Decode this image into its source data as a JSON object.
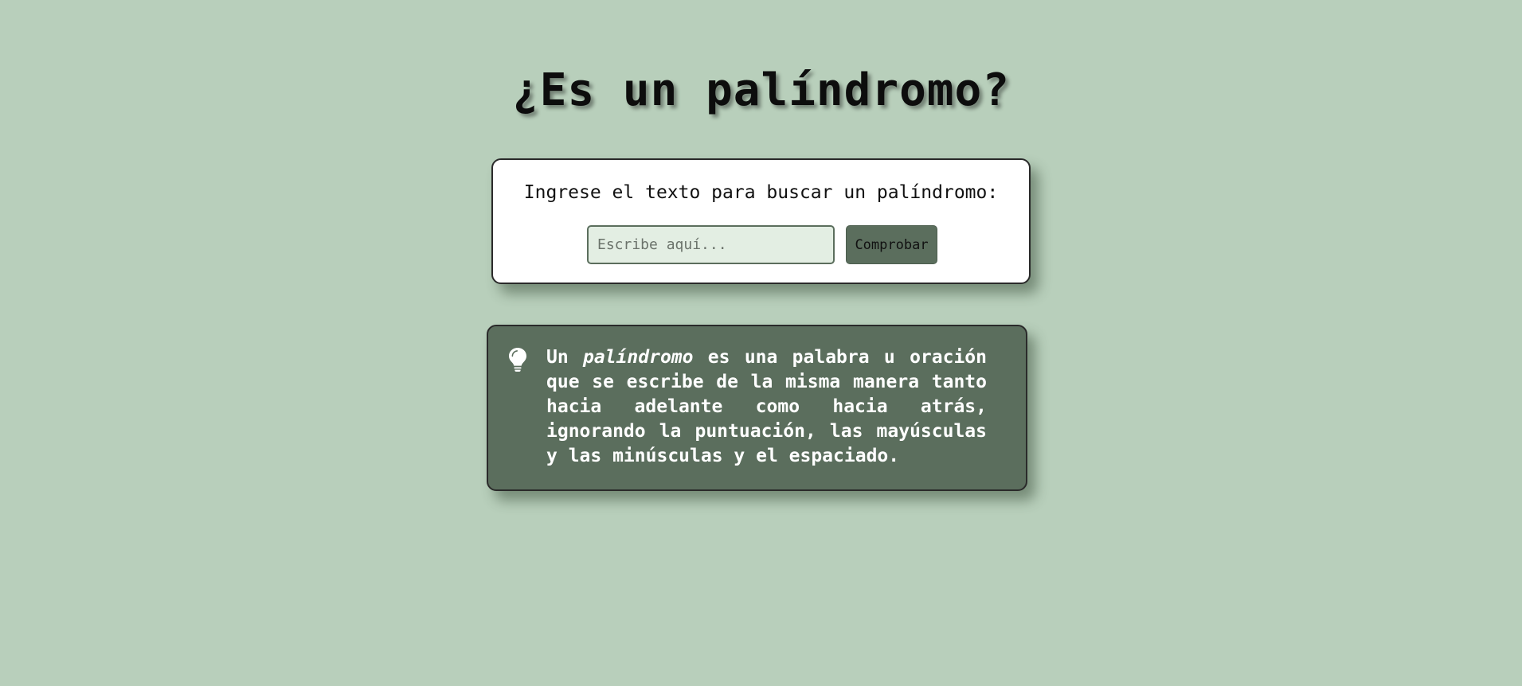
{
  "header": {
    "title": "¿Es un palíndromo?"
  },
  "checker": {
    "label": "Ingrese el texto para buscar un palíndromo:",
    "input_value": "",
    "input_placeholder": "Escribe aquí...",
    "button_label": "Comprobar"
  },
  "info": {
    "icon": "lightbulb-icon",
    "text_before": "Un ",
    "text_emphasis": "palíndromo",
    "text_after": " es una palabra u oración que se escribe de la misma manera tanto hacia adelante como hacia atrás, ignorando la puntuación, las mayúsculas y las minúsculas y el espaciado."
  },
  "colors": {
    "background": "#b8cfbb",
    "accent": "#5b6e5d",
    "card": "#ffffff",
    "input_background": "#e3eee3",
    "text_light": "#ffffff",
    "text_dark": "#111111"
  }
}
